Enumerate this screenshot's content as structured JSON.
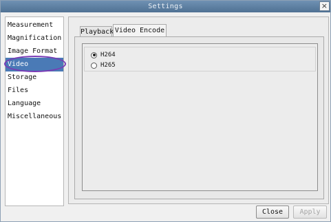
{
  "window": {
    "title": "Settings",
    "close_glyph": "×"
  },
  "sidebar": {
    "items": [
      {
        "label": "Measurement",
        "selected": false
      },
      {
        "label": "Magnification",
        "selected": false
      },
      {
        "label": "Image Format",
        "selected": false
      },
      {
        "label": "Video",
        "selected": true
      },
      {
        "label": "Storage",
        "selected": false
      },
      {
        "label": "Files",
        "selected": false
      },
      {
        "label": "Language",
        "selected": false
      },
      {
        "label": "Miscellaneous",
        "selected": false
      }
    ],
    "highlight_color": "#7a3bb5",
    "selected_color": "#4a7ab6"
  },
  "tabs": [
    {
      "label": "Playback",
      "active": false
    },
    {
      "label": "Video Encode",
      "active": true
    }
  ],
  "encode": {
    "options": [
      {
        "label": "H264",
        "checked": true
      },
      {
        "label": "H265",
        "checked": false
      }
    ]
  },
  "buttons": {
    "close": "Close",
    "apply": "Apply"
  }
}
